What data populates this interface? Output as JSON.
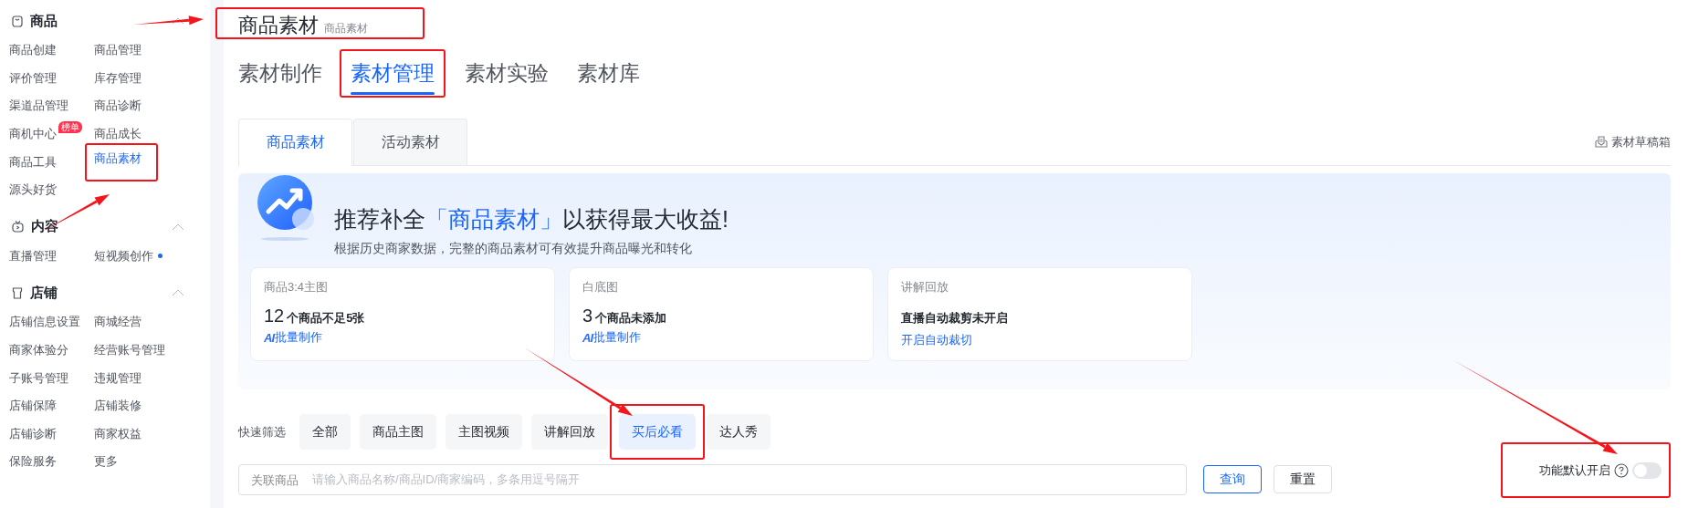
{
  "sidebar": {
    "sections": [
      {
        "title": "商品",
        "expanded": true,
        "items": [
          {
            "label": "商品创建",
            "selected": false
          },
          {
            "label": "商品管理",
            "selected": false
          },
          {
            "label": "评价管理",
            "selected": false
          },
          {
            "label": "库存管理",
            "selected": false
          },
          {
            "label": "渠道品管理",
            "selected": false
          },
          {
            "label": "商品诊断",
            "selected": false
          },
          {
            "label": "商机中心",
            "selected": false,
            "badge": "榜单"
          },
          {
            "label": "商品成长",
            "selected": false
          },
          {
            "label": "商品工具",
            "selected": false
          },
          {
            "label": "商品素材",
            "selected": true,
            "highlighted": true
          },
          {
            "label": "源头好货",
            "selected": false
          }
        ]
      },
      {
        "title": "内容",
        "expanded": true,
        "items": [
          {
            "label": "直播管理",
            "selected": false
          },
          {
            "label": "短视频创作",
            "selected": false,
            "new_dot": true
          }
        ]
      },
      {
        "title": "店铺",
        "expanded": true,
        "items": [
          {
            "label": "店铺信息设置",
            "selected": false
          },
          {
            "label": "商城经营",
            "selected": false
          },
          {
            "label": "商家体验分",
            "selected": false
          },
          {
            "label": "经营账号管理",
            "selected": false
          },
          {
            "label": "子账号管理",
            "selected": false
          },
          {
            "label": "违规管理",
            "selected": false
          },
          {
            "label": "店铺保障",
            "selected": false
          },
          {
            "label": "店铺装修",
            "selected": false
          },
          {
            "label": "店铺诊断",
            "selected": false
          },
          {
            "label": "商家权益",
            "selected": false
          },
          {
            "label": "保险服务",
            "selected": false
          },
          {
            "label": "更多",
            "selected": false
          }
        ]
      }
    ]
  },
  "header": {
    "title": "商品素材",
    "subtitle": "商品素材",
    "highlighted": true
  },
  "tabs": [
    {
      "label": "素材制作",
      "selected": false
    },
    {
      "label": "素材管理",
      "selected": true,
      "highlighted": true
    },
    {
      "label": "素材实验",
      "selected": false
    },
    {
      "label": "素材库",
      "selected": false
    }
  ],
  "sub_tabs": [
    {
      "label": "商品素材",
      "selected": true
    },
    {
      "label": "活动素材",
      "selected": false
    }
  ],
  "drafts_link": "素材草稿箱",
  "banner": {
    "title_before": "推荐补全",
    "title_highlight": "「商品素材」",
    "title_after": "以获得最大收益!",
    "subtitle": "根据历史商家数据，完整的商品素材可有效提升商品曝光和转化",
    "cards": [
      {
        "label": "商品3:4主图",
        "count": "12",
        "summary": "个商品不足5张",
        "ai_prefix": "AI",
        "action": "批量制作"
      },
      {
        "label": "白底图",
        "count": "3",
        "summary": "个商品未添加",
        "ai_prefix": "AI",
        "action": "批量制作"
      },
      {
        "label": "讲解回放",
        "summary": "直播自动裁剪未开启",
        "action": "开启自动裁切"
      }
    ]
  },
  "quick_filter": {
    "label": "快速筛选",
    "chips": [
      {
        "label": "全部",
        "selected": false
      },
      {
        "label": "商品主图",
        "selected": false
      },
      {
        "label": "主图视频",
        "selected": false
      },
      {
        "label": "讲解回放",
        "selected": false
      },
      {
        "label": "买后必看",
        "selected": true,
        "highlighted": true
      },
      {
        "label": "达人秀",
        "selected": false
      }
    ]
  },
  "search": {
    "label": "关联商品",
    "placeholder": "请输入商品名称/商品ID/商家编码，多条用逗号隔开"
  },
  "buttons": [
    {
      "label": "查询",
      "kind": "primary"
    },
    {
      "label": "重置",
      "kind": "default"
    }
  ],
  "default_toggle": {
    "label": "功能默认开启",
    "on": false,
    "highlighted": true
  }
}
